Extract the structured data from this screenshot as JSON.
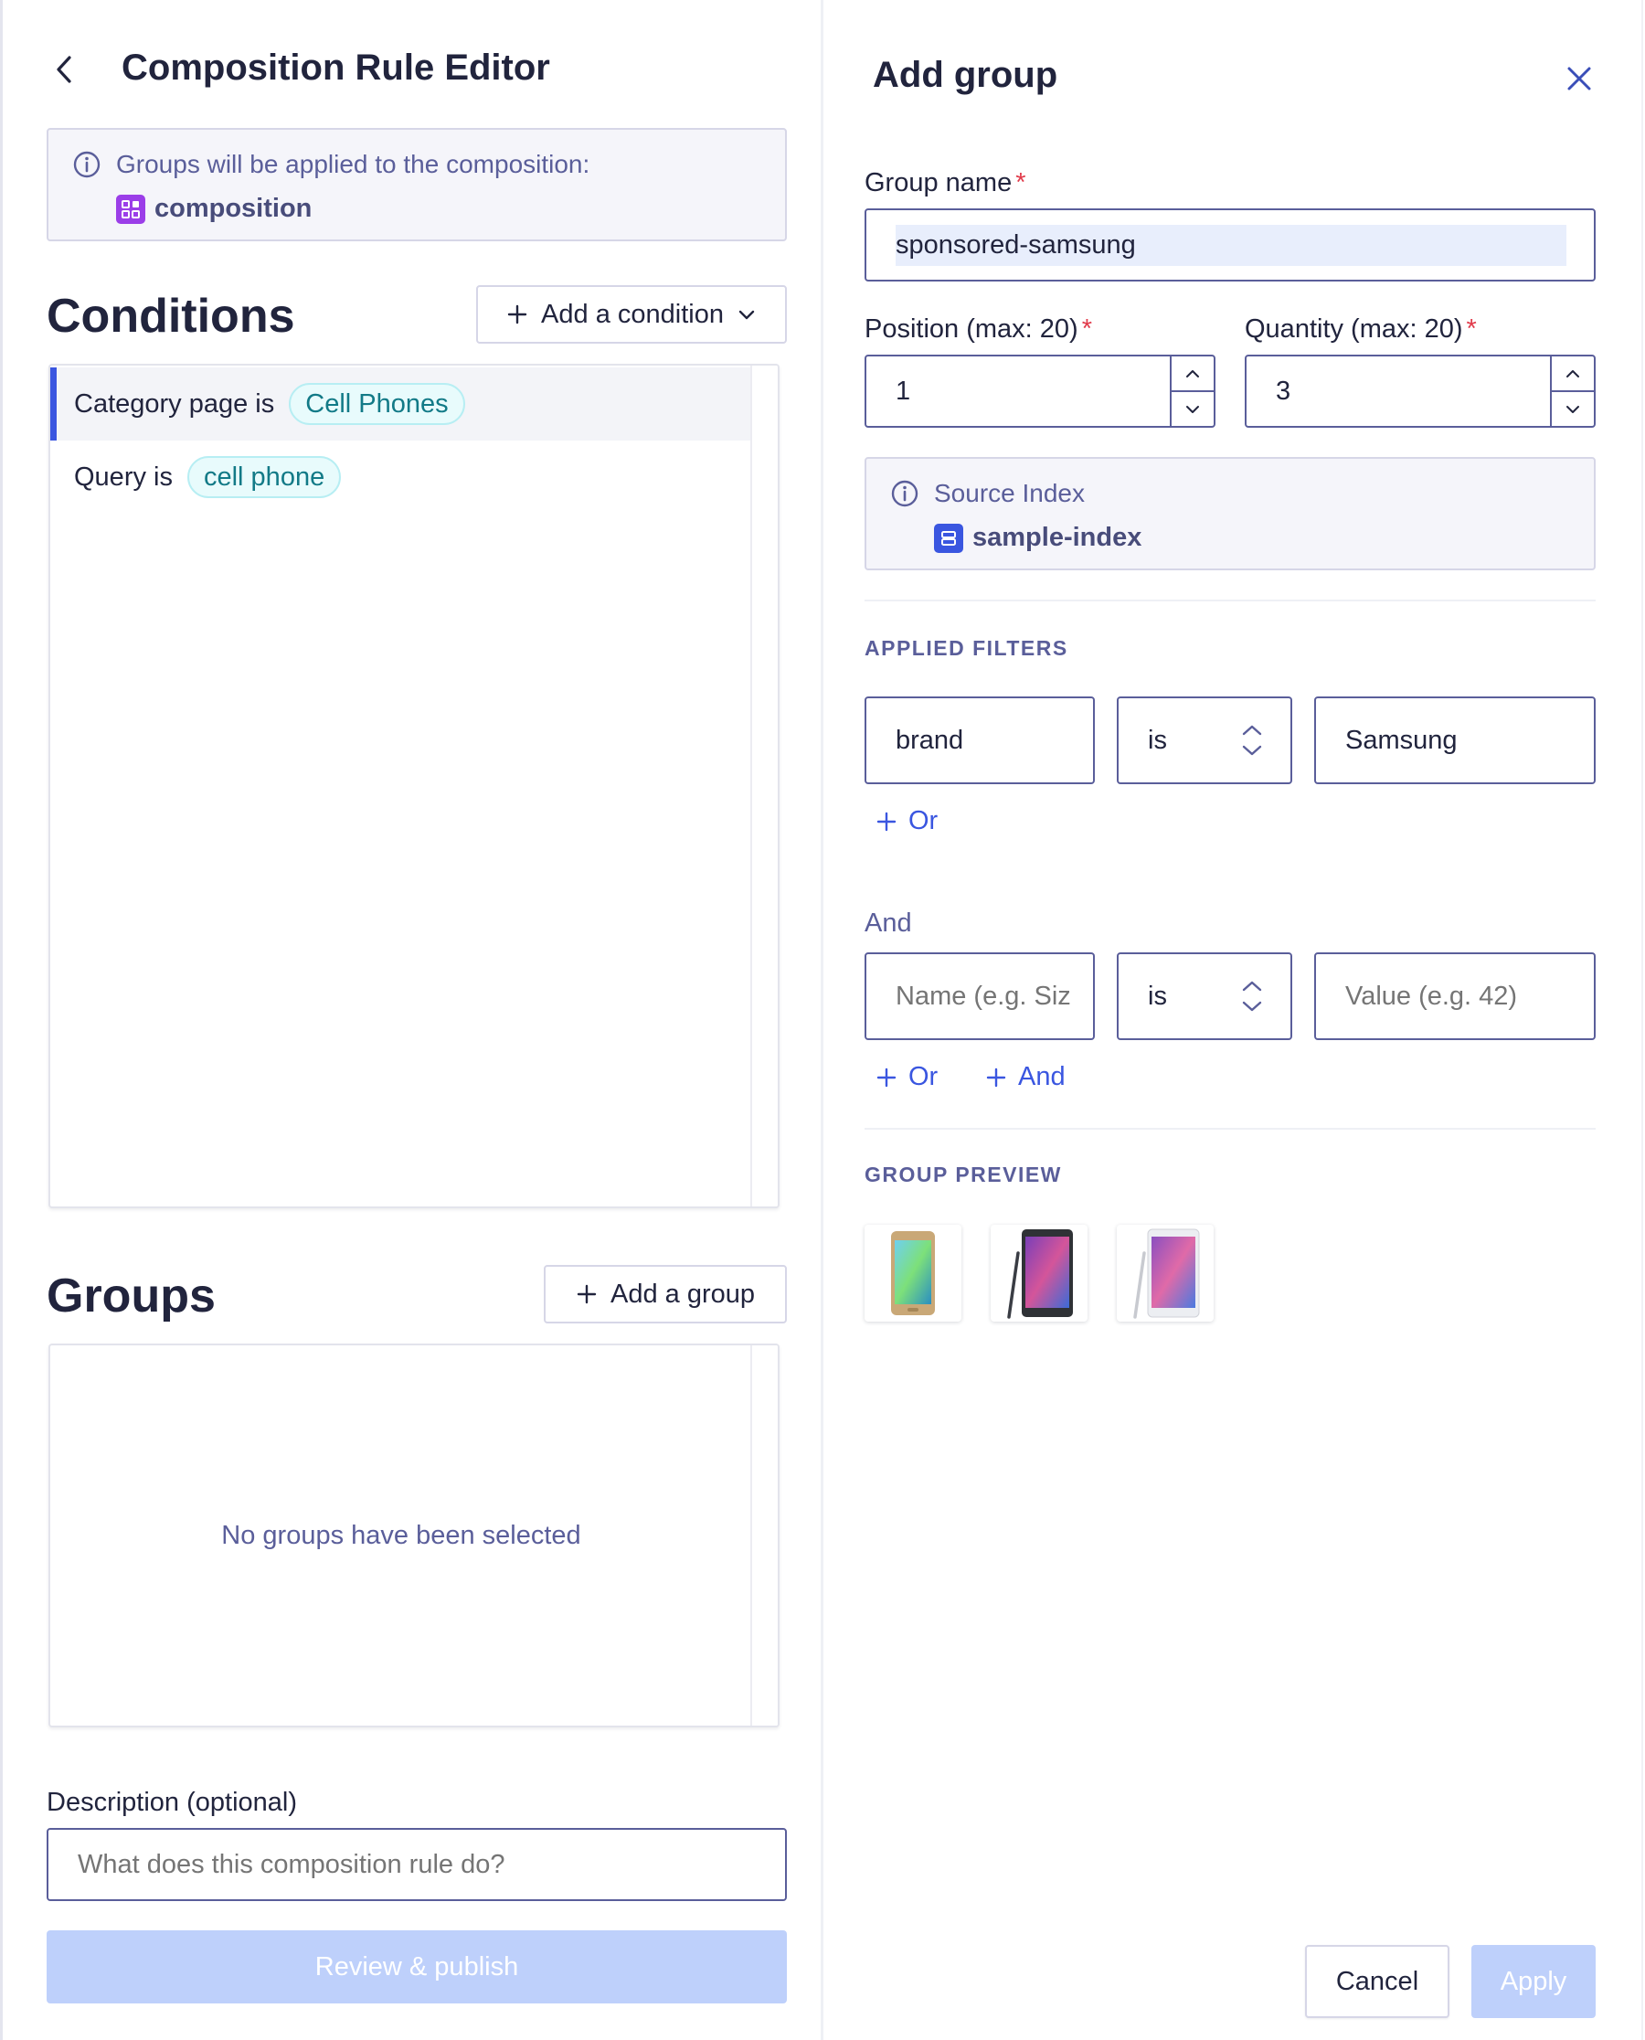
{
  "editor": {
    "title": "Composition Rule Editor",
    "info_text": "Groups will be applied to the composition:",
    "composition_name": "composition"
  },
  "conditions": {
    "title": "Conditions",
    "add_label": "Add a condition",
    "items": [
      {
        "label": "Category page is",
        "value": "Cell Phones"
      },
      {
        "label": "Query is",
        "value": "cell phone"
      }
    ]
  },
  "groups": {
    "title": "Groups",
    "add_label": "Add a group",
    "empty_text": "No groups have been selected"
  },
  "description": {
    "label": "Description (optional)",
    "placeholder": "What does this composition rule do?"
  },
  "review_label": "Review & publish",
  "add_group": {
    "title": "Add group",
    "group_name_label": "Group name",
    "group_name_value": "sponsored-samsung",
    "position_label": "Position (max: 20)",
    "position_value": "1",
    "quantity_label": "Quantity (max: 20)",
    "quantity_value": "3",
    "source_index_label": "Source Index",
    "source_index_value": "sample-index",
    "applied_filters_label": "APPLIED FILTERS",
    "filters": [
      {
        "name": "brand",
        "operator": "is",
        "value": "Samsung"
      }
    ],
    "or_label": "Or",
    "and_section_label": "And",
    "and_button_label": "And",
    "new_filter": {
      "name_placeholder": "Name (e.g. Siz",
      "operator": "is",
      "value_placeholder": "Value (e.g. 42)"
    },
    "group_preview_label": "GROUP PREVIEW",
    "cancel_label": "Cancel",
    "apply_label": "Apply"
  },
  "colors": {
    "accent": "#3a56e0",
    "tag_bg": "#e8fbfc",
    "tag_text": "#127a87",
    "composition_icon": "#9b3ee8",
    "index_icon": "#3a56e0",
    "disabled_primary": "#bed0fb"
  }
}
